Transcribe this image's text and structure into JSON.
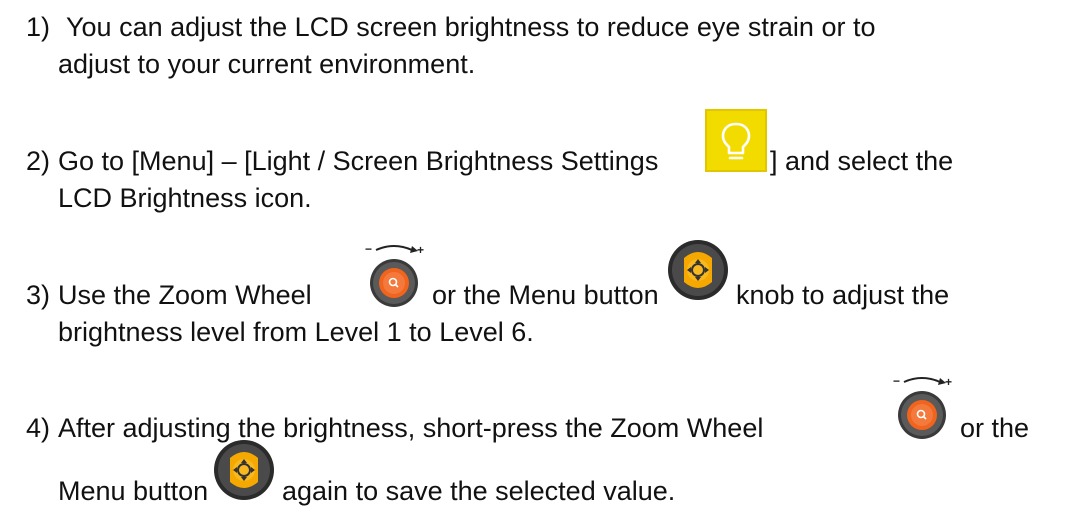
{
  "steps": [
    {
      "number": "1)",
      "lines": [
        "You can adjust the LCD screen brightness to reduce eye strain or to",
        "adjust to your current environment."
      ]
    },
    {
      "number": "2)",
      "line1_before": "Go to [Menu] – [Light / Screen Brightness Settings",
      "line1_after": "] and select the",
      "line2": "LCD Brightness icon."
    },
    {
      "number": "3)",
      "line1_a": "Use the Zoom Wheel",
      "line1_b": "or the Menu button",
      "line1_c": "knob to adjust the",
      "line2": "brightness level from Level 1 to Level 6."
    },
    {
      "number": "4)",
      "line1_a": "After adjusting the brightness, short-press the Zoom Wheel",
      "line1_b": "or the",
      "line2_a": "Menu button",
      "line2_b": "again to save the selected value."
    }
  ],
  "icons": {
    "lightbulb": "lightbulb-icon",
    "zoom_wheel": "zoom-wheel-icon",
    "menu_button": "menu-button-icon"
  },
  "colors": {
    "bulb_bg": "#f2dc00",
    "wheel_orange": "#f0641e",
    "menu_orange": "#f5a800",
    "knob_dark": "#2b2b2b"
  }
}
